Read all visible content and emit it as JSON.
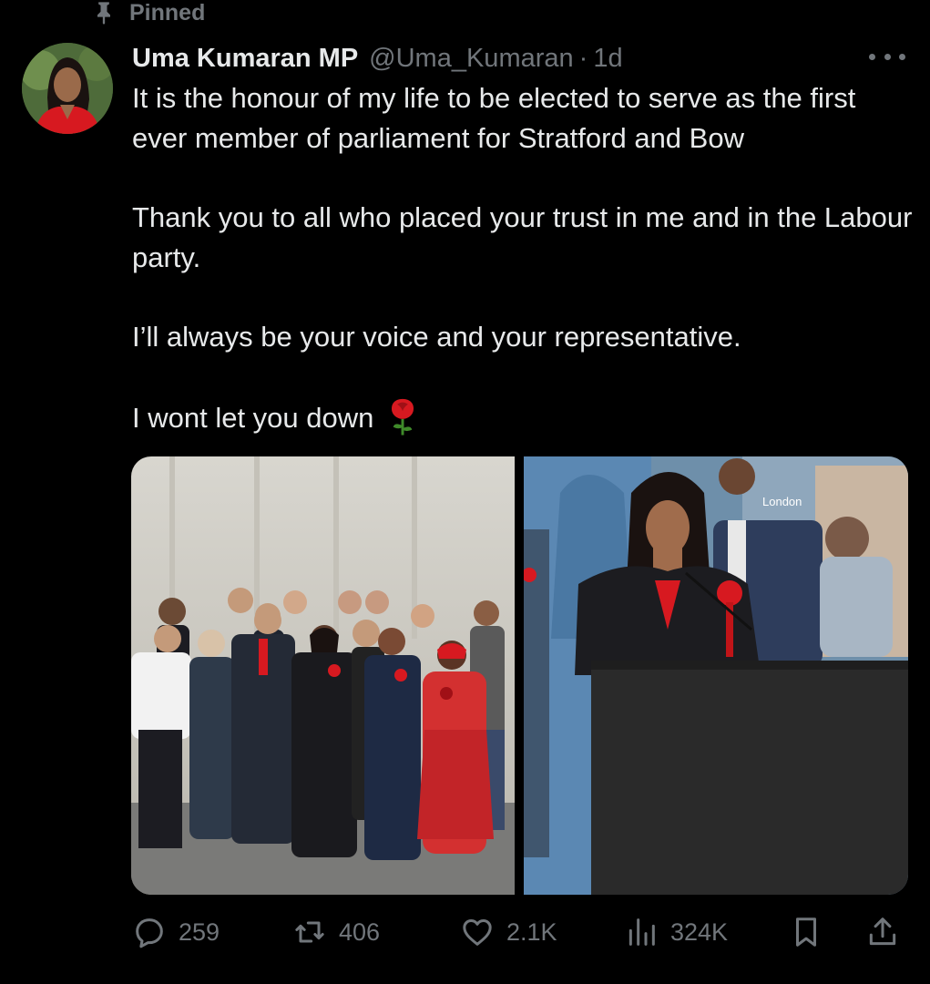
{
  "pinned": {
    "label": "Pinned"
  },
  "author": {
    "display_name": "Uma Kumaran MP",
    "handle": "@Uma_Kumaran",
    "separator": "·",
    "time": "1d"
  },
  "tweet": {
    "paragraphs": [
      "It is the honour of my life to be elected to serve as the first ever member of parliament for Stratford and Bow",
      "Thank you to all who placed your trust in me and in the Labour party.",
      "I’ll always be your voice and your representative.",
      "I wont let you down"
    ],
    "emoji": "rose-icon"
  },
  "media": {
    "right_photo_sign": "London"
  },
  "actions": {
    "replies": "259",
    "reposts": "406",
    "likes": "2.1K",
    "views": "324K"
  },
  "icons": {
    "pin": "pin-icon",
    "more": "more-icon",
    "reply": "reply-icon",
    "repost": "repost-icon",
    "like": "heart-icon",
    "views": "views-icon",
    "bookmark": "bookmark-icon",
    "share": "share-icon"
  },
  "colors": {
    "background": "#000000",
    "text": "#e7e9ea",
    "secondary": "#71767b",
    "labour_red": "#d71920"
  }
}
